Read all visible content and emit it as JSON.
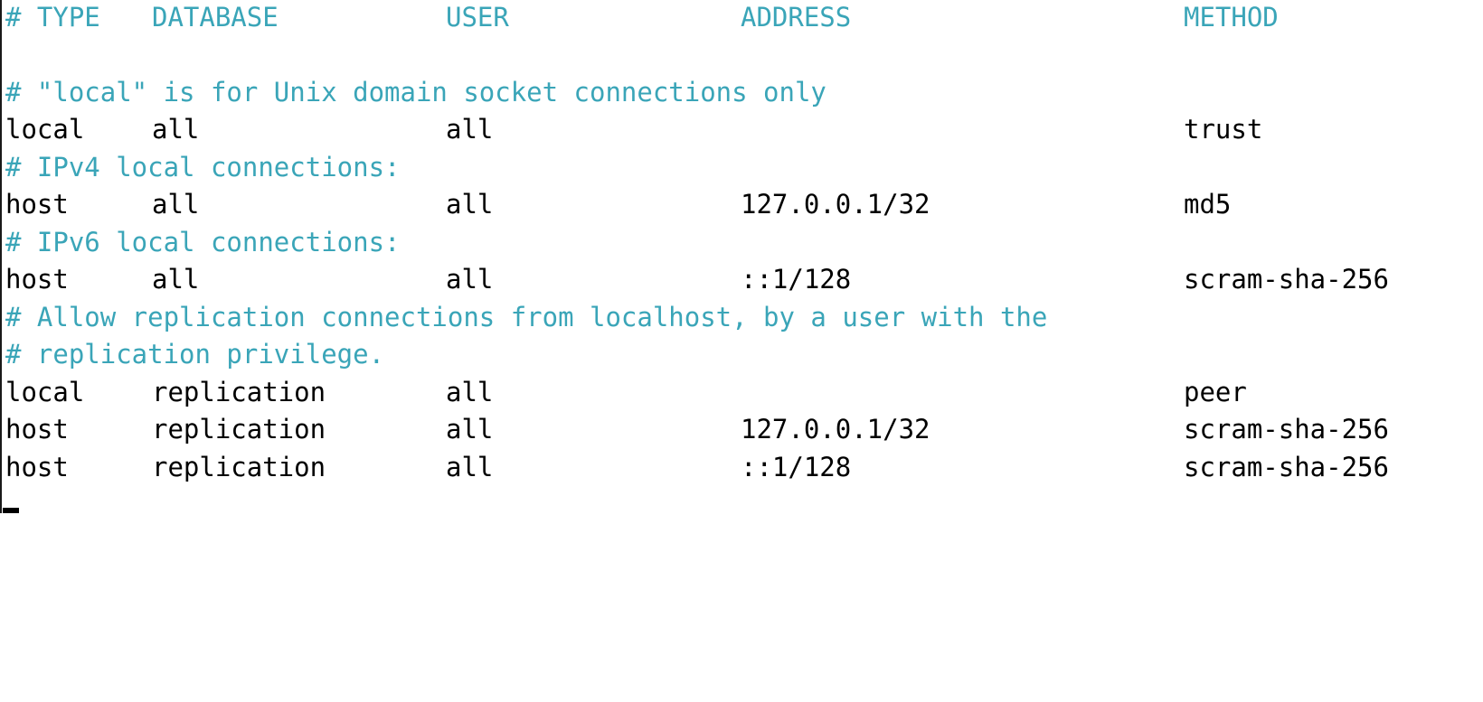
{
  "header": {
    "type": "# TYPE",
    "database": "DATABASE",
    "user": "USER",
    "address": "ADDRESS",
    "method": "METHOD"
  },
  "comments": {
    "local_only": "# \"local\" is for Unix domain socket connections only",
    "ipv4": "# IPv4 local connections:",
    "ipv6": "# IPv6 local connections:",
    "replication_1": "# Allow replication connections from localhost, by a user with the",
    "replication_2": "# replication privilege."
  },
  "rows": [
    {
      "type": "local",
      "database": "all",
      "user": "all",
      "address": "",
      "method": "trust"
    },
    {
      "type": "host",
      "database": "all",
      "user": "all",
      "address": "127.0.0.1/32",
      "method": "md5"
    },
    {
      "type": "host",
      "database": "all",
      "user": "all",
      "address": "::1/128",
      "method": "scram-sha-256"
    },
    {
      "type": "local",
      "database": "replication",
      "user": "all",
      "address": "",
      "method": "peer"
    },
    {
      "type": "host",
      "database": "replication",
      "user": "all",
      "address": "127.0.0.1/32",
      "method": "scram-sha-256"
    },
    {
      "type": "host",
      "database": "replication",
      "user": "all",
      "address": "::1/128",
      "method": "scram-sha-256"
    }
  ]
}
